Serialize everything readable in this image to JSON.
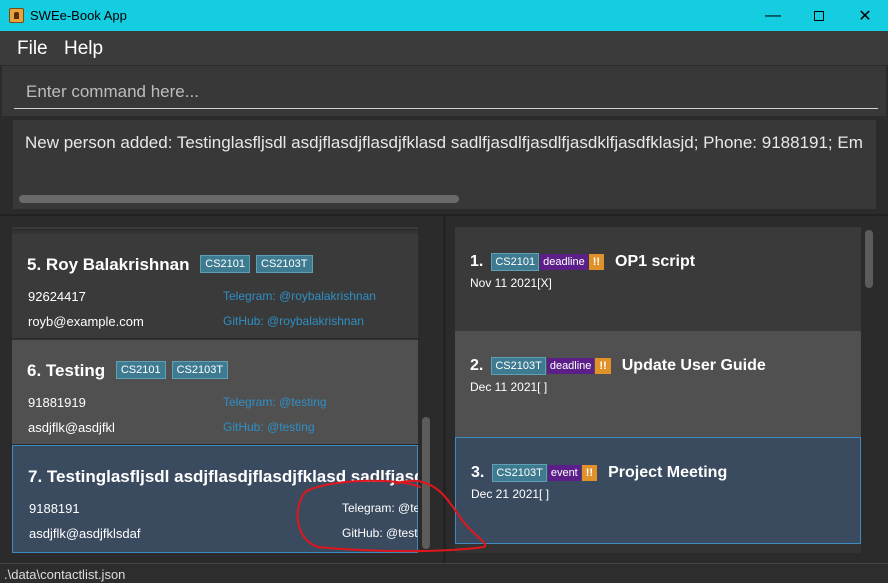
{
  "window": {
    "title": "SWEe-Book App",
    "minimize_symbol": "—",
    "close_symbol": "✕"
  },
  "menu": {
    "file_label": "File",
    "help_label": "Help"
  },
  "command": {
    "placeholder": "Enter command here..."
  },
  "result": {
    "text": "New person added: Testinglasfljsdl asdjflasdjflasdjfklasd sadlfjasdlfjasdlfjasdklfjasdfklasjd; Phone: 9188191; Em"
  },
  "persons": [
    {
      "index": "5.",
      "name": "Roy Balakrishnan",
      "tags": [
        "CS2101",
        "CS2103T"
      ],
      "phone": "92624417",
      "email": "royb@example.com",
      "telegram": "Telegram: @roybalakrishnan",
      "github": "GitHub: @roybalakrishnan"
    },
    {
      "index": "6.",
      "name": "Testing",
      "tags": [
        "CS2101",
        "CS2103T"
      ],
      "phone": "91881919",
      "email": "asdjflk@asdjfkl",
      "telegram": "Telegram: @testing",
      "github": "GitHub: @testing"
    },
    {
      "index": "7.",
      "name": "Testinglasfljsdl asdjflasdjflasdjfklasd sadlfjasdlfj",
      "tags": [],
      "phone": "9188191",
      "email": "asdjflk@asdjfklsdaf",
      "telegram": "Telegram: @te",
      "github": "GitHub: @testi"
    }
  ],
  "tasks": [
    {
      "index": "1.",
      "module": "CS2101",
      "type": "deadline",
      "priority": "!!",
      "title": "OP1 script",
      "date": "Nov 11 2021[X]"
    },
    {
      "index": "2.",
      "module": "CS2103T",
      "type": "deadline",
      "priority": "!!",
      "title": "Update User Guide",
      "date": "Dec 11 2021[ ]"
    },
    {
      "index": "3.",
      "module": "CS2103T",
      "type": "event",
      "priority": "!!",
      "title": "Project Meeting",
      "date": "Dec 21 2021[ ]"
    }
  ],
  "status": {
    "path": ".\\data\\contactlist.json"
  },
  "colors": {
    "titlebar": "#14cde0",
    "tag_module": "#3e7b91",
    "tag_type": "#5c1f8a",
    "tag_priority": "#e0912a",
    "link": "#2f8fc4",
    "annotation": "#e0161c"
  },
  "icons": {
    "app": "app-icon",
    "minimize": "minimize-icon",
    "maximize": "maximize-icon",
    "close": "close-icon"
  }
}
